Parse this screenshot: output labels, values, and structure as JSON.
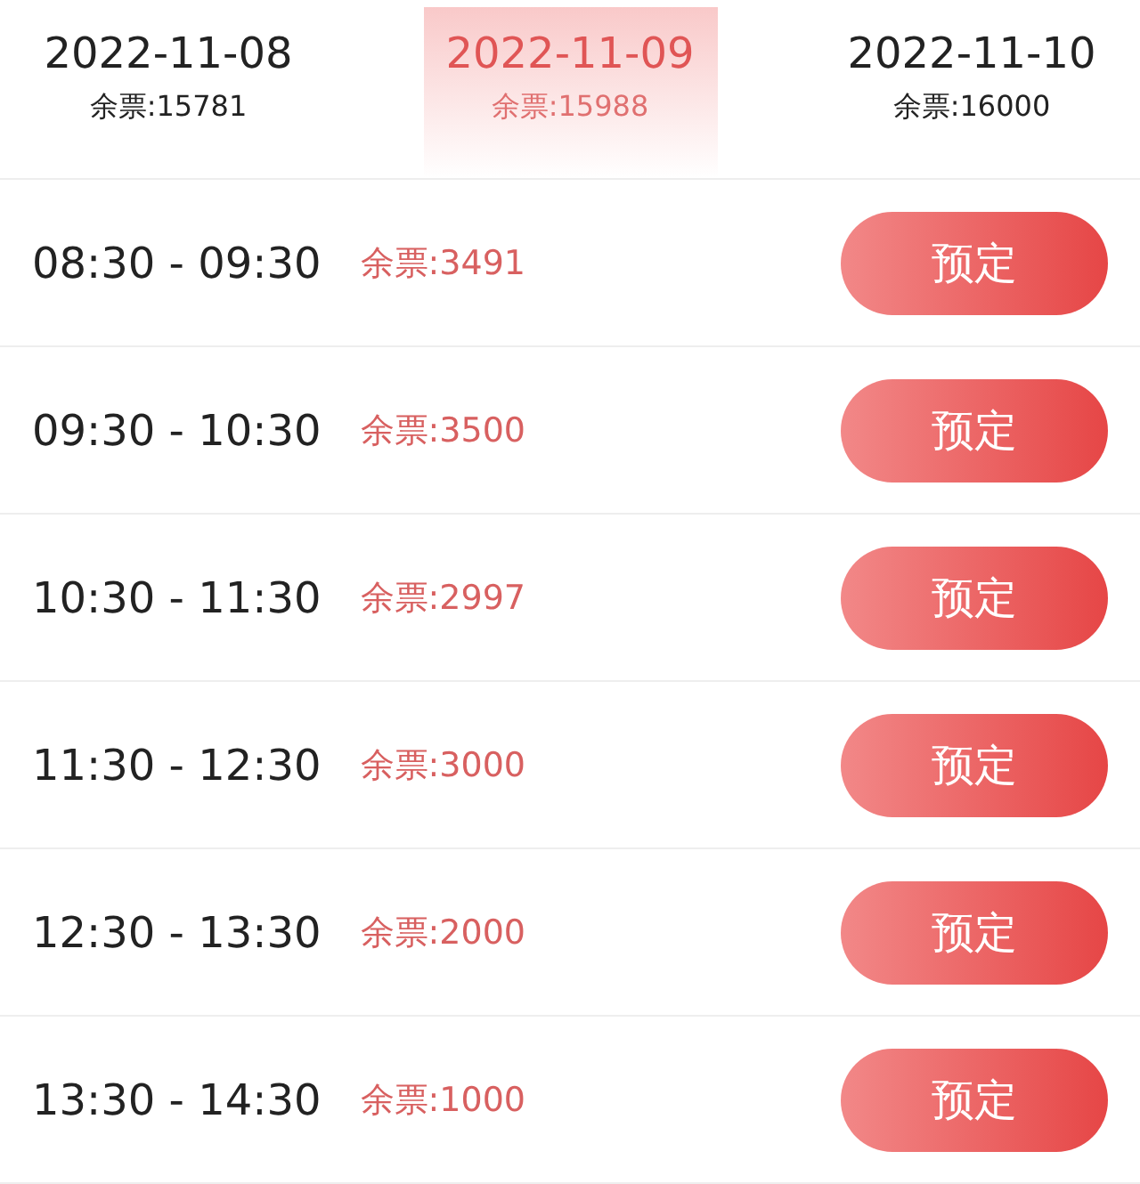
{
  "date_tabs": [
    {
      "date": "2022-11-08",
      "remaining": "余票:15781",
      "selected": false
    },
    {
      "date": "2022-11-09",
      "remaining": "余票:15988",
      "selected": true
    },
    {
      "date": "2022-11-10",
      "remaining": "余票:16000",
      "selected": false
    }
  ],
  "slots": [
    {
      "time": "08:30 - 09:30",
      "remaining": "余票:3491",
      "button": "预定"
    },
    {
      "time": "09:30 - 10:30",
      "remaining": "余票:3500",
      "button": "预定"
    },
    {
      "time": "10:30 - 11:30",
      "remaining": "余票:2997",
      "button": "预定"
    },
    {
      "time": "11:30 - 12:30",
      "remaining": "余票:3000",
      "button": "预定"
    },
    {
      "time": "12:30 - 13:30",
      "remaining": "余票:2000",
      "button": "预定"
    },
    {
      "time": "13:30 - 14:30",
      "remaining": "余票:1000",
      "button": "预定"
    }
  ]
}
